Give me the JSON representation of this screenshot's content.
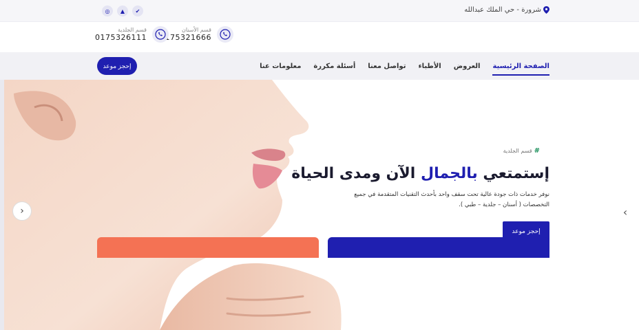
{
  "topbar": {
    "location": "شرورة - حي الملك عبدالله",
    "social": [
      {
        "icon": "instagram-icon",
        "glyph": "◎"
      },
      {
        "icon": "snapchat-icon",
        "glyph": "▲"
      },
      {
        "icon": "twitter-icon",
        "glyph": "✔"
      }
    ]
  },
  "contacts": [
    {
      "label": "قسم الأسنان",
      "number": "0175321666"
    },
    {
      "label": "قسم الجلدية",
      "number": "0175326111"
    }
  ],
  "nav": {
    "items": [
      "الصفحة الرئيسية",
      "العروض",
      "الأطباء",
      "تواصل معنا",
      "أسئلة مكررة",
      "معلومات عنا"
    ],
    "active_index": 0,
    "cta": "إحجز موعد"
  },
  "hero": {
    "eyebrow": "قسم الجلدية",
    "headline_pre": "إستمتعي ",
    "headline_highlight": "بالجمال",
    "headline_post": " الآن ومدى الحياة",
    "description": "نوفر خدمات ذات جودة عالية تحت سقف واحد بأحدث التقنيات المتقدمة في جميع التخصصات ( أسنان – جلدية – طبي ).",
    "cta": "إحجز موعد"
  },
  "colors": {
    "primary": "#1f1fb0",
    "accent": "#f47254",
    "success": "#1a8f5a"
  }
}
